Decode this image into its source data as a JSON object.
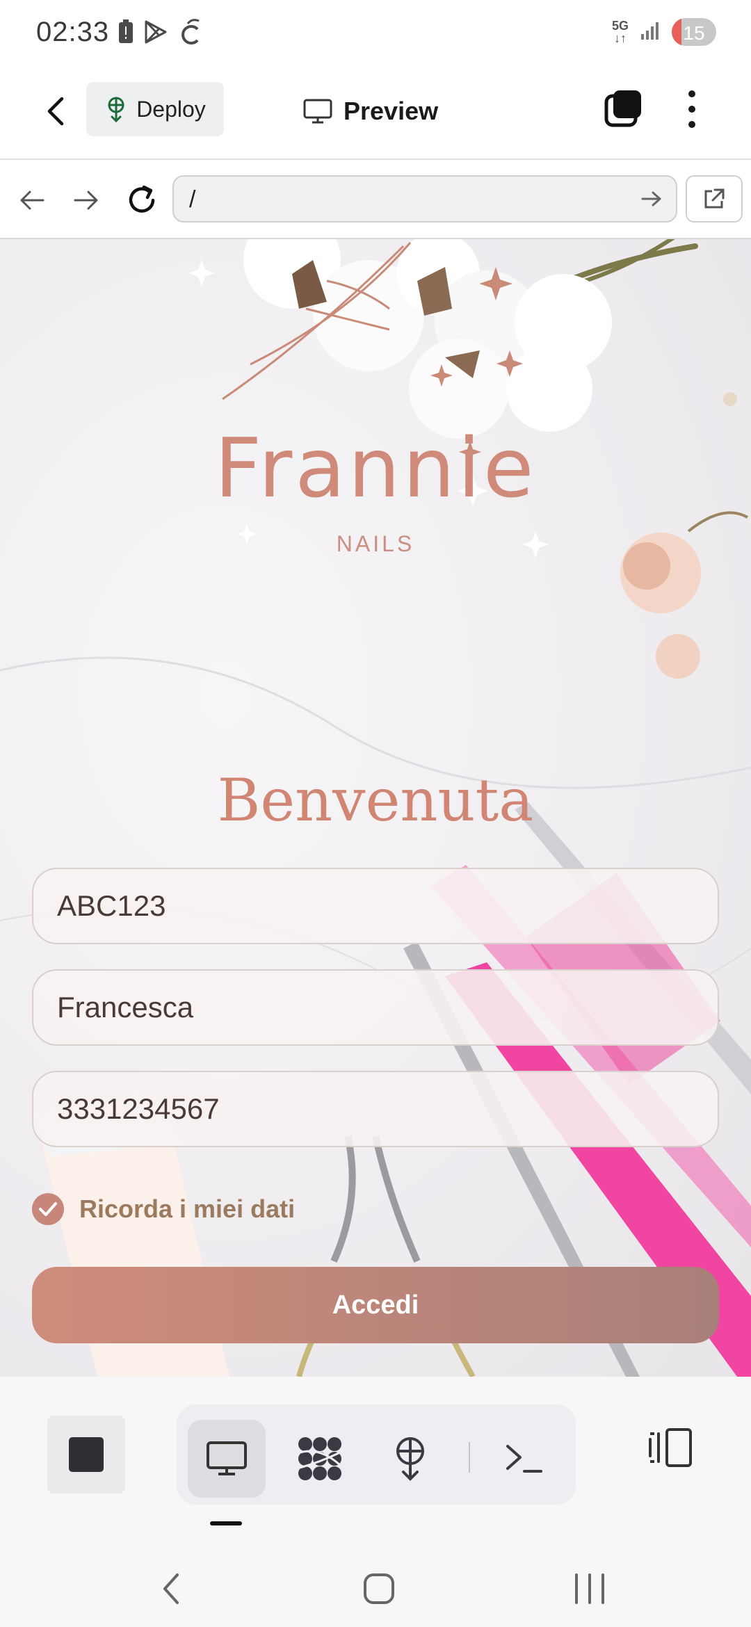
{
  "status_bar": {
    "time": "02:33",
    "network": "5G",
    "battery_level": "15"
  },
  "header": {
    "deploy_label": "Deploy",
    "title": "Preview"
  },
  "browser": {
    "url": "/"
  },
  "page": {
    "brand_name": "Frannie",
    "brand_subtitle": "NAILS",
    "welcome": "Benvenuta",
    "fields": {
      "code_value": "ABC123",
      "name_value": "Francesca",
      "phone_value": "3331234567"
    },
    "remember_label": "Ricorda i miei dati",
    "remember_checked": true,
    "login_label": "Accedi"
  },
  "toolbar": {
    "items": [
      "stop",
      "preview",
      "packages",
      "deploy",
      "terminal",
      "split"
    ],
    "active": "preview"
  },
  "colors": {
    "brand": "#cf8a79",
    "button_start": "#cf8c7a",
    "button_end": "#a88079",
    "checkbox": "#c6877a"
  }
}
